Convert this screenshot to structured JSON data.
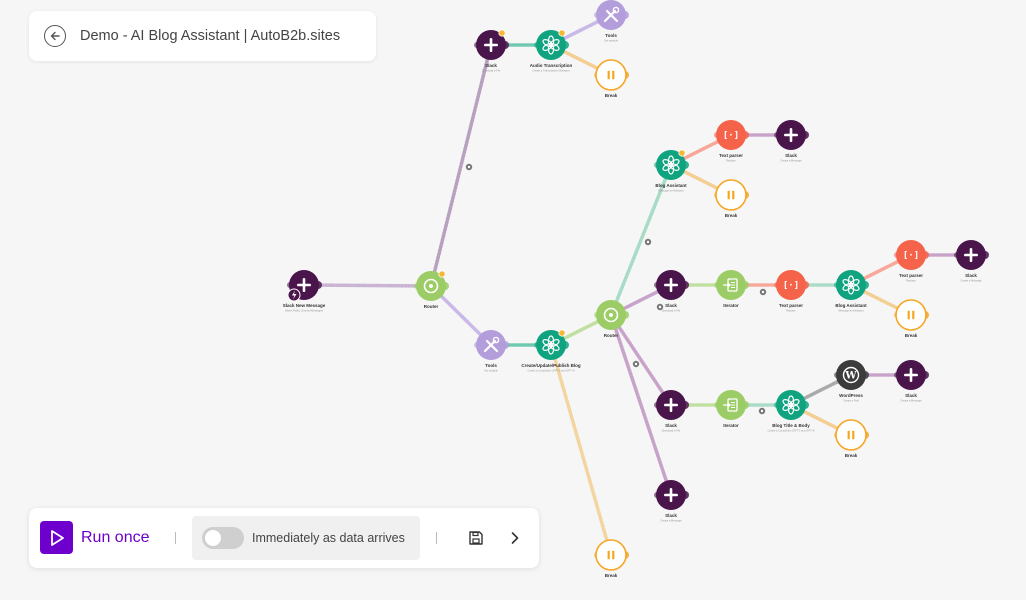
{
  "header": {
    "title": "Demo - AI Blog Assistant | AutoB2b.sites",
    "back_icon": "back-arrow-icon"
  },
  "controls": {
    "run_label": "Run once",
    "schedule_label": "Immediately as data arrives",
    "schedule_enabled": false,
    "save_icon": "save-icon",
    "expand_icon": "chevron-right-icon",
    "accent_color": "#6d00cc"
  },
  "colors": {
    "slack": "#4a154b",
    "openai": "#10a37f",
    "router": "#9ccc65",
    "tools": "#b39ddb",
    "break": "#f5a623",
    "text_parser": "#f4634a",
    "iterator": "#9ccc65",
    "wordpress": "#3c3c3c"
  },
  "scenario": {
    "nodes": [
      {
        "id": "trigger",
        "type": "slack",
        "label": "Slack New Message",
        "sublabel": "Watch Public Channel Messages"
      },
      {
        "id": "router1",
        "type": "router",
        "label": "Router",
        "sublabel": ""
      },
      {
        "id": "slack_top",
        "type": "slack",
        "label": "Slack",
        "sublabel": "Download a File"
      },
      {
        "id": "audio",
        "type": "openai",
        "label": "Audio Transcription",
        "sublabel": "Create a Transcription (Whisper)"
      },
      {
        "id": "tools_top",
        "type": "tools",
        "label": "Tools",
        "sublabel": "Set variable"
      },
      {
        "id": "break_top",
        "type": "break",
        "label": "Break",
        "sublabel": ""
      },
      {
        "id": "tools_mid",
        "type": "tools",
        "label": "Tools",
        "sublabel": "Set variable"
      },
      {
        "id": "create_blog",
        "type": "openai",
        "label": "Create/Update/Publish Blog",
        "sublabel": "Create a Completion (GPT-3 and GPT-4)"
      },
      {
        "id": "router2",
        "type": "router",
        "label": "Router",
        "sublabel": ""
      },
      {
        "id": "blog_asst1",
        "type": "openai",
        "label": "Blog Assistant",
        "sublabel": "Message an Assistant"
      },
      {
        "id": "text_parser1",
        "type": "text_parser",
        "label": "Text parser",
        "sublabel": "Replace"
      },
      {
        "id": "slack_r1",
        "type": "slack",
        "label": "Slack",
        "sublabel": "Create a Message"
      },
      {
        "id": "break_r1",
        "type": "break",
        "label": "Break",
        "sublabel": ""
      },
      {
        "id": "slack_m1",
        "type": "slack",
        "label": "Slack",
        "sublabel": "Download a File"
      },
      {
        "id": "iterator1",
        "type": "iterator",
        "label": "Iterator",
        "sublabel": ""
      },
      {
        "id": "text_parser2",
        "type": "text_parser",
        "label": "Text parser",
        "sublabel": "Replace"
      },
      {
        "id": "blog_asst2",
        "type": "openai",
        "label": "Blog Assistant",
        "sublabel": "Message an Assistant"
      },
      {
        "id": "text_parser3",
        "type": "text_parser",
        "label": "Text parser",
        "sublabel": "Replace"
      },
      {
        "id": "slack_r2",
        "type": "slack",
        "label": "Slack",
        "sublabel": "Create a Message"
      },
      {
        "id": "break_r2",
        "type": "break",
        "label": "Break",
        "sublabel": ""
      },
      {
        "id": "slack_m2",
        "type": "slack",
        "label": "Slack",
        "sublabel": "Download a File"
      },
      {
        "id": "iterator2",
        "type": "iterator",
        "label": "Iterator",
        "sublabel": ""
      },
      {
        "id": "blog_title",
        "type": "openai",
        "label": "Blog Title & Body",
        "sublabel": "Create a Completion (GPT-3 and GPT-4)"
      },
      {
        "id": "wordpress",
        "type": "wordpress",
        "label": "WordPress",
        "sublabel": "Create a Post"
      },
      {
        "id": "slack_r3",
        "type": "slack",
        "label": "Slack",
        "sublabel": "Create a Message"
      },
      {
        "id": "break_r3",
        "type": "break",
        "label": "Break",
        "sublabel": ""
      },
      {
        "id": "slack_bottom",
        "type": "slack",
        "label": "Slack",
        "sublabel": "Create a Message"
      },
      {
        "id": "break_bottom",
        "type": "break",
        "label": "Break",
        "sublabel": ""
      }
    ]
  }
}
